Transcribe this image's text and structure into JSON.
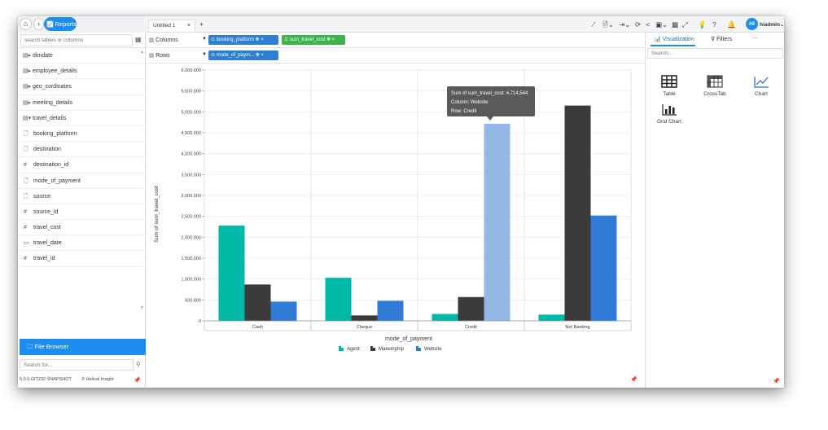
{
  "sidebar": {
    "reports_label": "Reports",
    "search_placeholder": "search tables or columns",
    "tables": [
      {
        "name": "dimdate",
        "icon": "table-icon",
        "expanded": false
      },
      {
        "name": "employee_details",
        "icon": "table-icon",
        "expanded": false
      },
      {
        "name": "geo_cordinates",
        "icon": "table-icon",
        "expanded": false
      },
      {
        "name": "meeting_details",
        "icon": "table-icon",
        "expanded": false
      },
      {
        "name": "travel_details",
        "icon": "table-icon",
        "expanded": true
      }
    ],
    "columns": [
      {
        "name": "booking_platform",
        "icon": "text-icon"
      },
      {
        "name": "destination",
        "icon": "text-icon"
      },
      {
        "name": "destination_id",
        "icon": "number-icon"
      },
      {
        "name": "mode_of_payment",
        "icon": "text-icon"
      },
      {
        "name": "source",
        "icon": "text-icon"
      },
      {
        "name": "source_id",
        "icon": "number-icon"
      },
      {
        "name": "travel_cost",
        "icon": "number-icon"
      },
      {
        "name": "travel_date",
        "icon": "date-icon"
      },
      {
        "name": "travel_id",
        "icon": "number-icon"
      }
    ],
    "file_browser_label": "File Browser",
    "search_for_placeholder": "Search for...",
    "version": "5.0.0.GIT232 SNAPSHOT",
    "brand": "Helical Insight"
  },
  "topbar": {
    "tab_label": "Untitled 1",
    "avatar_initials": "HI",
    "username": "hiadmin"
  },
  "shelves": {
    "columns_label": "Columns",
    "rows_label": "Rows",
    "column_pills": [
      {
        "label": "booking_platform",
        "color": "#2d7fd3"
      },
      {
        "label": "sum_travel_cost",
        "color": "#3bb54a"
      }
    ],
    "row_pills": [
      {
        "label": "mode_of_paym...",
        "color": "#2d7fd3"
      }
    ]
  },
  "right_panel": {
    "tab_visualization": "Visualization",
    "tab_filters": "Filters",
    "search_placeholder": "Search...",
    "viz_types": [
      "Table",
      "CrossTab",
      "Chart",
      "Grid Chart"
    ]
  },
  "chart_data": {
    "type": "bar",
    "xlabel": "mode_of_payment",
    "ylabel": "Sum of sum_travel_cost",
    "ylim": [
      0,
      6000000
    ],
    "yticks": [
      "0",
      "500,000",
      "1,000,000",
      "1,500,000",
      "2,000,000",
      "2,500,000",
      "3,000,000",
      "3,500,000",
      "4,000,000",
      "4,500,000",
      "5,000,000",
      "5,500,000",
      "6,000,000"
    ],
    "categories": [
      "Cash",
      "Cheque",
      "Credit",
      "Net Banking"
    ],
    "series": [
      {
        "name": "Agent",
        "color": "#00b9a7",
        "values": [
          2280000,
          1030000,
          165000,
          150000
        ]
      },
      {
        "name": "Makemytrip",
        "color": "#3b3b3b",
        "values": [
          870000,
          130000,
          570000,
          5150000
        ]
      },
      {
        "name": "Website",
        "color": "#2f7bd6",
        "values": [
          460000,
          480000,
          4714544,
          2520000
        ]
      }
    ],
    "highlight": {
      "series": 2,
      "category": 2,
      "color": "#93b8e6"
    },
    "tooltip": {
      "line1": "Sum of sum_travel_cost: 4,714,544",
      "line2": "Column: Website",
      "line3": "Row: Credit"
    },
    "grid": true,
    "legend": "bottom"
  }
}
